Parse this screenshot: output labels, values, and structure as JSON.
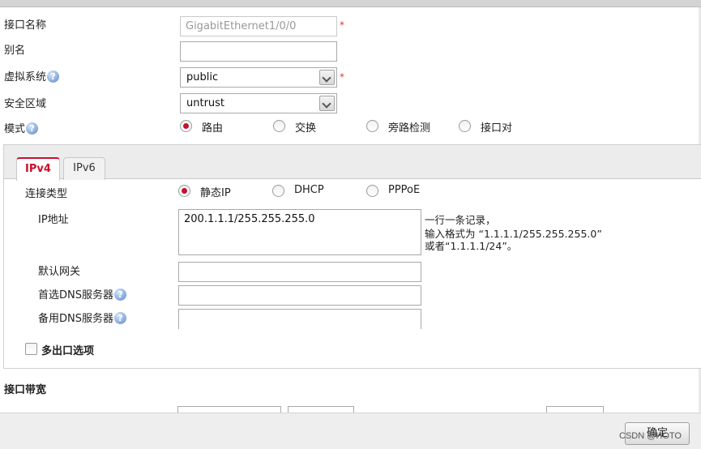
{
  "form": {
    "interface_name_label": "接口名称",
    "interface_name_value": "GigabitEthernet1/0/0",
    "alias_label": "别名",
    "alias_value": "",
    "vsys_label": "虚拟系统",
    "vsys_value": "public",
    "zone_label": "安全区域",
    "zone_value": "untrust",
    "mode_label": "模式",
    "mode_options": [
      "路由",
      "交换",
      "旁路检测",
      "接口对"
    ],
    "mode_selected": "路由",
    "required_mark": "*",
    "help_glyph": "?"
  },
  "tabs": [
    {
      "label": "IPv4",
      "active": true
    },
    {
      "label": "IPv6",
      "active": false
    }
  ],
  "ipv4": {
    "conn_type_label": "连接类型",
    "conn_options": [
      "静态IP",
      "DHCP",
      "PPPoE"
    ],
    "conn_selected": "静态IP",
    "ip_label": "IP地址",
    "ip_value": "200.1.1.1/255.255.255.0",
    "hint_line1": "一行一条记录，",
    "hint_line2": "输入格式为 “1.1.1.1/255.255.255.0”",
    "hint_line3": "或者“1.1.1.1/24”。",
    "gateway_label": "默认网关",
    "gateway_value": "",
    "dns1_label": "首选DNS服务器",
    "dns1_value": "",
    "dns2_label": "备用DNS服务器",
    "dns2_value": "",
    "multi_exit_label": "多出口选项"
  },
  "bandwidth": {
    "title": "接口带宽"
  },
  "footer": {
    "ok_label": "确定",
    "watermark": "CSDN @HOTO"
  },
  "colors": {
    "accent": "#c8102e",
    "required": "#e03a3a",
    "help_icon": "#7da4d8"
  }
}
